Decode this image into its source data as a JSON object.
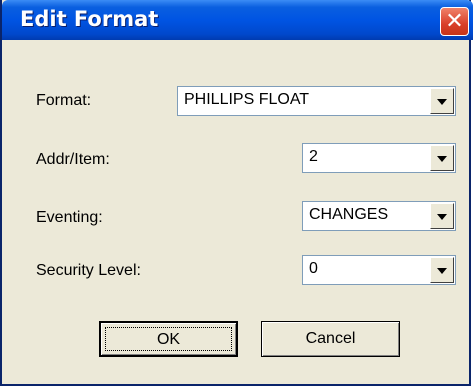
{
  "window": {
    "title": "Edit Format",
    "close_glyph": "✕"
  },
  "form": {
    "format": {
      "label": "Format:",
      "value": "PHILLIPS FLOAT"
    },
    "addr_item": {
      "label": "Addr/Item:",
      "value": "2"
    },
    "eventing": {
      "label": "Eventing:",
      "value": "CHANGES"
    },
    "security_level": {
      "label": "Security Level:",
      "value": "0"
    }
  },
  "buttons": {
    "ok": "OK",
    "cancel": "Cancel"
  },
  "colors": {
    "titlebar": "#0054e3",
    "dialog_bg": "#ece9d8",
    "close_button": "#d9402a"
  }
}
